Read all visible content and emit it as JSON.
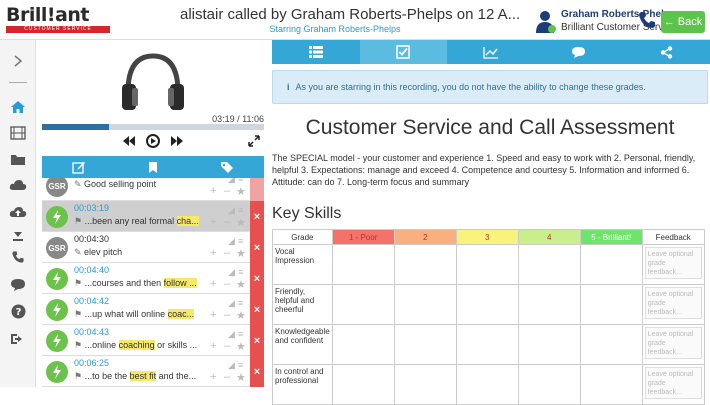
{
  "brand": {
    "name": "Brill!ant",
    "tagline": "CUSTOMER SERVICE"
  },
  "call": {
    "title": "alistair called by Graham Roberts-Phelps on 12 A...",
    "subtitle": "Starring Graham Roberts-Phelps"
  },
  "user": {
    "name": "Graham Roberts-Phelps",
    "org": "Brilliant Customer Servi..."
  },
  "back_label": "← Back",
  "player": {
    "time": "03:19 / 11:06",
    "progress": 0.3
  },
  "clips": [
    {
      "initials": "GSR",
      "time": "",
      "icon": "edit-icon",
      "text": "Good selling point",
      "hl": "",
      "selected": false,
      "type": "note"
    },
    {
      "initials": "",
      "time": "00:03:19",
      "icon": "tag-icon",
      "text": "...been any real formal ",
      "hl": "cha...",
      "selected": true,
      "type": "auto"
    },
    {
      "initials": "GSR",
      "time": "00:04:30",
      "icon": "edit-icon",
      "text": "elev pitch",
      "hl": "",
      "selected": false,
      "type": "note"
    },
    {
      "initials": "",
      "time": "00:04:40",
      "icon": "tag-icon",
      "text": "...courses and then ",
      "hl": "follow ...",
      "selected": false,
      "type": "auto"
    },
    {
      "initials": "",
      "time": "00:04:42",
      "icon": "tag-icon",
      "text": "...up what will online ",
      "hl": "coac...",
      "selected": false,
      "type": "auto"
    },
    {
      "initials": "",
      "time": "00:04:43",
      "icon": "tag-icon",
      "text": "...online ",
      "hl": "coaching",
      "after": " or skills ...",
      "selected": false,
      "type": "auto"
    },
    {
      "initials": "",
      "time": "00:06:25",
      "icon": "tag-icon",
      "text": "...to be the ",
      "hl": "best fit",
      "after": " and the...",
      "selected": false,
      "type": "auto"
    }
  ],
  "info_text": "As you are starring in this recording, you do not have the ability to change these grades.",
  "assessment_title": "Customer Service and Call Assessment",
  "description": "The SPECIAL model - your customer and experience 1. Speed and easy to work with 2. Personal, friendly, helpful 3. Expectations: manage and exceed 4. Competence and courtesy 5. Information and informed 6. Attitude: can do 7. Long-term focus and summary",
  "key_skills_heading": "Key Skills",
  "grades": {
    "headers": [
      "Grade",
      "1 - Poor",
      "2",
      "3",
      "4",
      "5 - Brilliant!",
      "Feedback"
    ],
    "colors": [
      "#ffffff",
      "#f4726a",
      "#f9b07c",
      "#f7f37b",
      "#c9ef8c",
      "#6ee46a",
      "#ffffff"
    ],
    "rows": [
      "Vocal Impression",
      "Friendly, helpful and cheerful",
      "Knowledgeable and confident",
      "In control and professional"
    ],
    "feedback_placeholder": "Leave optional grade feedback..."
  }
}
